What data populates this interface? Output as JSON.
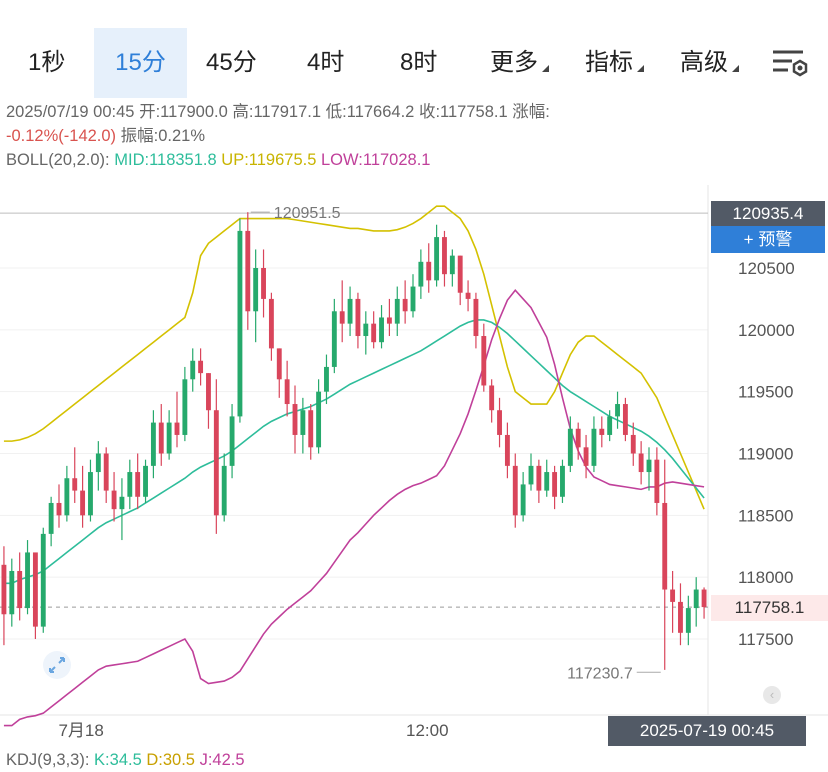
{
  "tabs": [
    {
      "label": "1秒",
      "has_menu": false,
      "active": false
    },
    {
      "label": "15分",
      "has_menu": false,
      "active": true
    },
    {
      "label": "45分",
      "has_menu": false,
      "active": false
    },
    {
      "label": "4时",
      "has_menu": false,
      "active": false
    },
    {
      "label": "8时",
      "has_menu": false,
      "active": false
    },
    {
      "label": "更多",
      "has_menu": true,
      "active": false
    },
    {
      "label": "指标",
      "has_menu": true,
      "active": false
    },
    {
      "label": "高级",
      "has_menu": true,
      "active": false
    }
  ],
  "settings_icon": "chart-settings-icon",
  "ohlc": {
    "datetime": "2025/07/19 00:45",
    "open_label": "开:",
    "open": "117900.0",
    "high_label": "高:",
    "high": "117917.1",
    "low_label": "低:",
    "low": "117664.2",
    "close_label": "收:",
    "close": "117758.1",
    "change_label": "涨幅:",
    "change": "-0.12%(-142.0)",
    "amplitude_label": "振幅:",
    "amplitude": "0.21%"
  },
  "boll": {
    "label": "BOLL(20,2.0):",
    "mid_label": "MID:",
    "mid": "118351.8",
    "up_label": "UP:",
    "up": "119675.5",
    "low_label": "LOW:",
    "low": "117028.1"
  },
  "kdj": {
    "label": "KDJ(9,3,3):",
    "k_label": "K:",
    "k": "34.5",
    "d_label": "D:",
    "d": "30.5",
    "j_label": "J:",
    "j": "42.5"
  },
  "axis": {
    "top_price": "120935.4",
    "alert_button": "+ 预警",
    "current_price": "117758.1",
    "hover_time": "2025-07-19 00:45"
  },
  "annotations": {
    "high": "120951.5",
    "low": "117230.7"
  },
  "colors": {
    "up": "#26a96c",
    "down": "#d9455b",
    "mid": "#2ebd9b",
    "upper": "#d4c100",
    "lower": "#c0409a",
    "accent": "#2f7fd8"
  },
  "chart_data": {
    "type": "candlestick",
    "interval": "15分",
    "y_ticks": [
      117500,
      118000,
      118500,
      119000,
      119500,
      120000,
      120500
    ],
    "x_ticks": [
      "7月18",
      "12:00"
    ],
    "ylim": [
      117000,
      121200
    ],
    "candles": [
      [
        118100,
        118250,
        117450,
        117700
      ],
      [
        117700,
        118150,
        117600,
        118050
      ],
      [
        118050,
        118200,
        117650,
        117750
      ],
      [
        117750,
        118300,
        117700,
        118200
      ],
      [
        118200,
        118150,
        117500,
        117600
      ],
      [
        117600,
        118400,
        117550,
        118350
      ],
      [
        118350,
        118650,
        118250,
        118600
      ],
      [
        118600,
        118750,
        118400,
        118500
      ],
      [
        118500,
        118900,
        118450,
        118800
      ],
      [
        118800,
        119050,
        118600,
        118700
      ],
      [
        118700,
        118900,
        118400,
        118500
      ],
      [
        118500,
        118950,
        118450,
        118850
      ],
      [
        118850,
        119100,
        118700,
        119000
      ],
      [
        119000,
        119050,
        118600,
        118700
      ],
      [
        118700,
        118850,
        118450,
        118550
      ],
      [
        118550,
        118800,
        118300,
        118650
      ],
      [
        118650,
        118950,
        118550,
        118850
      ],
      [
        118850,
        119000,
        118550,
        118650
      ],
      [
        118650,
        118950,
        118600,
        118900
      ],
      [
        118900,
        119350,
        118800,
        119250
      ],
      [
        119250,
        119400,
        118900,
        119000
      ],
      [
        119000,
        119350,
        118950,
        119250
      ],
      [
        119250,
        119500,
        119050,
        119150
      ],
      [
        119150,
        119700,
        119100,
        119600
      ],
      [
        119600,
        119850,
        119500,
        119750
      ],
      [
        119750,
        119850,
        119550,
        119650
      ],
      [
        119650,
        119650,
        119200,
        119350
      ],
      [
        119350,
        119600,
        118350,
        118500
      ],
      [
        118500,
        119000,
        118450,
        118900
      ],
      [
        118900,
        119400,
        118800,
        119300
      ],
      [
        119300,
        120900,
        119250,
        120800
      ],
      [
        120800,
        120951.5,
        120000,
        120150
      ],
      [
        120150,
        120650,
        119900,
        120500
      ],
      [
        120500,
        120650,
        120100,
        120250
      ],
      [
        120250,
        120300,
        119750,
        119850
      ],
      [
        119850,
        119850,
        119450,
        119600
      ],
      [
        119600,
        119750,
        119300,
        119400
      ],
      [
        119400,
        119550,
        119000,
        119150
      ],
      [
        119150,
        119450,
        119000,
        119350
      ],
      [
        119350,
        119400,
        118950,
        119050
      ],
      [
        119050,
        119600,
        119000,
        119500
      ],
      [
        119500,
        119800,
        119400,
        119700
      ],
      [
        119700,
        120250,
        119650,
        120150
      ],
      [
        120150,
        120400,
        119900,
        120050
      ],
      [
        120050,
        120350,
        119950,
        120250
      ],
      [
        120250,
        120300,
        119850,
        119950
      ],
      [
        119950,
        120150,
        119800,
        120050
      ],
      [
        120050,
        120150,
        119850,
        119900
      ],
      [
        119900,
        120200,
        119850,
        120100
      ],
      [
        120100,
        120250,
        119950,
        120050
      ],
      [
        120050,
        120350,
        119950,
        120250
      ],
      [
        120250,
        120400,
        120050,
        120150
      ],
      [
        120150,
        120450,
        120100,
        120350
      ],
      [
        120350,
        120650,
        120250,
        120550
      ],
      [
        120550,
        120700,
        120300,
        120400
      ],
      [
        120400,
        120850,
        120350,
        120750
      ],
      [
        120750,
        120800,
        120350,
        120450
      ],
      [
        120450,
        120650,
        120350,
        120600
      ],
      [
        120600,
        120600,
        120200,
        120300
      ],
      [
        120300,
        120400,
        120150,
        120250
      ],
      [
        120250,
        120300,
        119850,
        119950
      ],
      [
        119950,
        120050,
        119500,
        119550
      ],
      [
        119550,
        119600,
        119250,
        119350
      ],
      [
        119350,
        119450,
        119050,
        119150
      ],
      [
        119150,
        119250,
        118800,
        118900
      ],
      [
        118900,
        119000,
        118400,
        118500
      ],
      [
        118500,
        118850,
        118450,
        118750
      ],
      [
        118750,
        119000,
        118700,
        118900
      ],
      [
        118900,
        118950,
        118600,
        118700
      ],
      [
        118700,
        118950,
        118650,
        118850
      ],
      [
        118850,
        118900,
        118550,
        118650
      ],
      [
        118650,
        118950,
        118600,
        118900
      ],
      [
        118900,
        119300,
        118850,
        119200
      ],
      [
        119200,
        119250,
        118950,
        119050
      ],
      [
        119050,
        119150,
        118800,
        118900
      ],
      [
        118900,
        119300,
        118850,
        119200
      ],
      [
        119200,
        119300,
        119050,
        119150
      ],
      [
        119150,
        119350,
        119100,
        119300
      ],
      [
        119300,
        119500,
        119200,
        119400
      ],
      [
        119400,
        119450,
        119100,
        119150
      ],
      [
        119150,
        119250,
        118900,
        119000
      ],
      [
        119000,
        119100,
        118750,
        118850
      ],
      [
        118850,
        119050,
        118700,
        118950
      ],
      [
        118950,
        119050,
        118500,
        118600
      ],
      [
        118600,
        118950,
        117250,
        117900
      ],
      [
        117900,
        118050,
        117550,
        117800
      ],
      [
        117800,
        117950,
        117450,
        117550
      ],
      [
        117550,
        117850,
        117450,
        117750
      ],
      [
        117750,
        118000,
        117600,
        117900
      ],
      [
        117900,
        117917.1,
        117664.2,
        117758.1
      ]
    ],
    "boll_mid": [
      117950,
      117950,
      117980,
      118000,
      118020,
      118050,
      118100,
      118150,
      118200,
      118250,
      118300,
      118350,
      118400,
      118440,
      118470,
      118500,
      118530,
      118560,
      118600,
      118640,
      118680,
      118720,
      118760,
      118800,
      118850,
      118890,
      118920,
      118950,
      118980,
      119020,
      119070,
      119120,
      119170,
      119220,
      119260,
      119290,
      119320,
      119340,
      119360,
      119380,
      119410,
      119440,
      119480,
      119520,
      119560,
      119590,
      119620,
      119650,
      119680,
      119710,
      119740,
      119770,
      119800,
      119830,
      119870,
      119910,
      119950,
      119990,
      120030,
      120060,
      120080,
      120080,
      120060,
      120020,
      119970,
      119910,
      119850,
      119790,
      119730,
      119670,
      119610,
      119550,
      119500,
      119460,
      119420,
      119380,
      119340,
      119300,
      119270,
      119240,
      119210,
      119180,
      119140,
      119090,
      119030,
      118960,
      118880,
      118800,
      118720,
      118640
    ],
    "boll_up": [
      119100,
      119100,
      119110,
      119130,
      119160,
      119200,
      119250,
      119300,
      119350,
      119400,
      119450,
      119500,
      119550,
      119600,
      119650,
      119700,
      119750,
      119800,
      119850,
      119900,
      119950,
      120000,
      120050,
      120100,
      120300,
      120600,
      120700,
      120750,
      120800,
      120850,
      120900,
      120900,
      120900,
      120900,
      120900,
      120900,
      120900,
      120890,
      120880,
      120870,
      120860,
      120850,
      120840,
      120830,
      120820,
      120820,
      120810,
      120800,
      120800,
      120800,
      120810,
      120830,
      120860,
      120900,
      120950,
      121000,
      121000,
      120950,
      120900,
      120800,
      120650,
      120450,
      120200,
      119950,
      119700,
      119500,
      119450,
      119400,
      119400,
      119400,
      119500,
      119650,
      119800,
      119900,
      119950,
      119950,
      119900,
      119850,
      119800,
      119750,
      119700,
      119650,
      119550,
      119450,
      119300,
      119150,
      119000,
      118850,
      118700,
      118550
    ],
    "boll_low": [
      116800,
      116800,
      116850,
      116870,
      116880,
      116900,
      116950,
      117000,
      117050,
      117100,
      117150,
      117200,
      117250,
      117280,
      117290,
      117300,
      117310,
      117320,
      117350,
      117380,
      117410,
      117440,
      117470,
      117500,
      117400,
      117180,
      117140,
      117150,
      117160,
      117190,
      117240,
      117340,
      117440,
      117540,
      117620,
      117680,
      117740,
      117790,
      117840,
      117890,
      117960,
      118030,
      118120,
      118210,
      118300,
      118360,
      118430,
      118500,
      118560,
      118620,
      118670,
      118710,
      118740,
      118760,
      118790,
      118820,
      118900,
      119030,
      119160,
      119320,
      119510,
      119710,
      119920,
      120090,
      120240,
      120320,
      120250,
      120180,
      120060,
      119940,
      119720,
      119450,
      119200,
      119020,
      118890,
      118810,
      118780,
      118750,
      118740,
      118730,
      118720,
      118710,
      118730,
      118730,
      118760,
      118770,
      118760,
      118750,
      118740,
      118730
    ]
  }
}
